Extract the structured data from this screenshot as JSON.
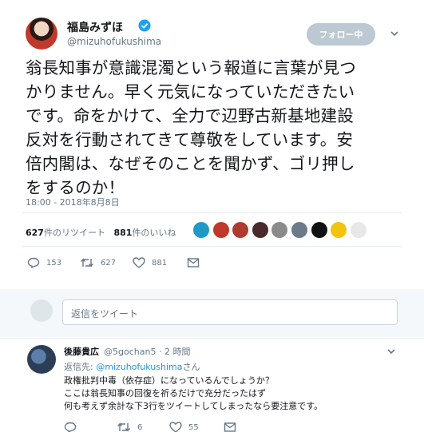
{
  "tweet": {
    "author_name": "福島みずほ",
    "author_handle": "@mizuhofukushima",
    "follow_label": "フォロー中",
    "text_lines": [
      "翁長知事が意識混濁という報道に言葉が見つ",
      "かりません。早く元気になっていただきたい",
      "です。命をかけて、全力で辺野古新基地建設",
      "反対を行動されてきて尊敬をしています。安",
      "倍内閣は、なぜそのことを聞かず、ゴリ押し",
      "をするのか！"
    ],
    "time": "18:00 - 2018年8月8日",
    "retweets_count": "627",
    "retweets_label": "件のリツイート",
    "likes_count": "881",
    "likes_label": "件のいいね",
    "reply_count": "153",
    "retweet_count_action": "627",
    "like_count_action": "881"
  },
  "likers": [
    {
      "color": "#1f9ac7"
    },
    {
      "color": "#c0392b"
    },
    {
      "color": "#b03a2e"
    },
    {
      "color": "#4a2a2a"
    },
    {
      "color": "#8a8a8a"
    },
    {
      "color": "#6c7a89"
    },
    {
      "color": "#111111"
    },
    {
      "color": "#f2c40f"
    },
    {
      "color": "#e8e8e8"
    }
  ],
  "reply_box": {
    "placeholder": "返信をツイート"
  },
  "reply": {
    "author_name": "後藤貴広",
    "author_handle": "@5gochan5",
    "time": "· 2 時間",
    "reply_to_prefix": "返信先: ",
    "reply_to_handle": "@mizuhofukushima",
    "reply_to_suffix": "さん",
    "text_lines": [
      "政権批判中毒（依存症）になっているんでしょうか？",
      "ここは翁長知事の回復を祈るだけで充分だったはず",
      "何も考えず余計な下3行をツイートしてしまったなら要注意です。"
    ],
    "retweet_count": "6",
    "like_count": "55"
  }
}
